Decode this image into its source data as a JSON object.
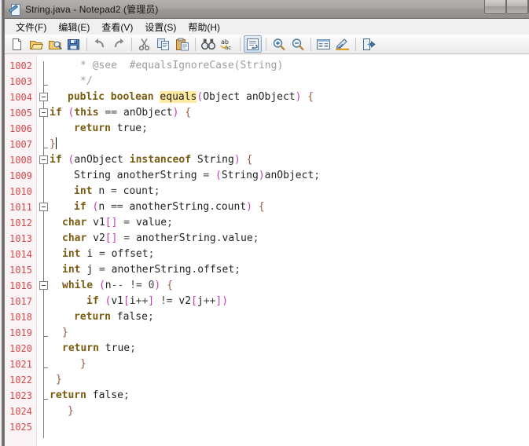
{
  "window": {
    "title": "String.java - Notepad2 (管理员)",
    "app_icon": "notepad2-icon"
  },
  "menubar": {
    "items": [
      {
        "label": "文件(F)",
        "name": "menu-file"
      },
      {
        "label": "编辑(E)",
        "name": "menu-edit"
      },
      {
        "label": "查看(V)",
        "name": "menu-view"
      },
      {
        "label": "设置(S)",
        "name": "menu-settings"
      },
      {
        "label": "帮助(H)",
        "name": "menu-help"
      }
    ]
  },
  "toolbar": {
    "buttons": [
      {
        "name": "new-file-icon",
        "title": "新建"
      },
      {
        "name": "open-file-icon",
        "title": "打开"
      },
      {
        "name": "browse-file-icon",
        "title": "浏览"
      },
      {
        "name": "save-file-icon",
        "title": "保存"
      },
      {
        "name": "separator-1",
        "title": ""
      },
      {
        "name": "undo-icon",
        "title": "撤销"
      },
      {
        "name": "redo-icon",
        "title": "重做"
      },
      {
        "name": "separator-2",
        "title": ""
      },
      {
        "name": "cut-icon",
        "title": "剪切"
      },
      {
        "name": "copy-icon",
        "title": "复制"
      },
      {
        "name": "paste-icon",
        "title": "粘贴"
      },
      {
        "name": "separator-3",
        "title": ""
      },
      {
        "name": "find-icon",
        "title": "查找"
      },
      {
        "name": "replace-icon",
        "title": "替换"
      },
      {
        "name": "separator-4",
        "title": ""
      },
      {
        "name": "word-wrap-icon",
        "title": "自动换行"
      },
      {
        "name": "separator-5",
        "title": ""
      },
      {
        "name": "zoom-in-icon",
        "title": "放大"
      },
      {
        "name": "zoom-out-icon",
        "title": "缩小"
      },
      {
        "name": "separator-6",
        "title": ""
      },
      {
        "name": "scheme-icon",
        "title": "方案"
      },
      {
        "name": "scheme-customize-icon",
        "title": "自定义方案"
      },
      {
        "name": "separator-7",
        "title": ""
      },
      {
        "name": "exit-icon",
        "title": "退出"
      }
    ]
  },
  "colors": {
    "line_number": "#d44848",
    "gutter_bg": "#fbf4f6",
    "keyword": "#7a5c12",
    "comment": "#9c9c9c",
    "paren": "#c23fb4",
    "brace": "#9a5a3a",
    "highlight_bg": "#ffeaa0",
    "editor_bg": "#ffffff",
    "titlebar": "#a9a6a4"
  },
  "editor": {
    "first_line": 1002,
    "last_line": 1025,
    "highlighted_word": "equals",
    "caret_line": 1007,
    "lines": [
      {
        "num": "1002",
        "indent": 5,
        "fold": "none",
        "text": "* @see  #equalsIgnoreCase(String)"
      },
      {
        "num": "1003",
        "indent": 5,
        "fold": "tick",
        "text": "*/"
      },
      {
        "num": "1004",
        "indent": 3,
        "fold": "box",
        "text": "public boolean equals(Object anObject) {"
      },
      {
        "num": "1005",
        "indent": 0,
        "fold": "box",
        "text": "if (this == anObject) {"
      },
      {
        "num": "1006",
        "indent": 4,
        "fold": "none",
        "text": "return true;"
      },
      {
        "num": "1007",
        "indent": 0,
        "fold": "tick",
        "text": "}"
      },
      {
        "num": "1008",
        "indent": 0,
        "fold": "box",
        "text": "if (anObject instanceof String) {"
      },
      {
        "num": "1009",
        "indent": 4,
        "fold": "none",
        "text": "String anotherString = (String)anObject;"
      },
      {
        "num": "1010",
        "indent": 4,
        "fold": "none",
        "text": "int n = count;"
      },
      {
        "num": "1011",
        "indent": 4,
        "fold": "box",
        "text": "if (n == anotherString.count) {"
      },
      {
        "num": "1012",
        "indent": 2,
        "fold": "none",
        "text": "char v1[] = value;"
      },
      {
        "num": "1013",
        "indent": 2,
        "fold": "none",
        "text": "char v2[] = anotherString.value;"
      },
      {
        "num": "1014",
        "indent": 2,
        "fold": "none",
        "text": "int i = offset;"
      },
      {
        "num": "1015",
        "indent": 2,
        "fold": "none",
        "text": "int j = anotherString.offset;"
      },
      {
        "num": "1016",
        "indent": 2,
        "fold": "box",
        "text": "while (n-- != 0) {"
      },
      {
        "num": "1017",
        "indent": 6,
        "fold": "none",
        "text": "if (v1[i++] != v2[j++])"
      },
      {
        "num": "1018",
        "indent": 4,
        "fold": "none",
        "text": "return false;"
      },
      {
        "num": "1019",
        "indent": 2,
        "fold": "tick",
        "text": "}"
      },
      {
        "num": "1020",
        "indent": 2,
        "fold": "none",
        "text": "return true;"
      },
      {
        "num": "1021",
        "indent": 5,
        "fold": "tick",
        "text": "}"
      },
      {
        "num": "1022",
        "indent": 1,
        "fold": "none",
        "text": "}"
      },
      {
        "num": "1023",
        "indent": 0,
        "fold": "tick",
        "text": "return false;"
      },
      {
        "num": "1024",
        "indent": 3,
        "fold": "none",
        "text": "}"
      },
      {
        "num": "1025",
        "indent": 0,
        "fold": "none",
        "text": ""
      }
    ]
  }
}
